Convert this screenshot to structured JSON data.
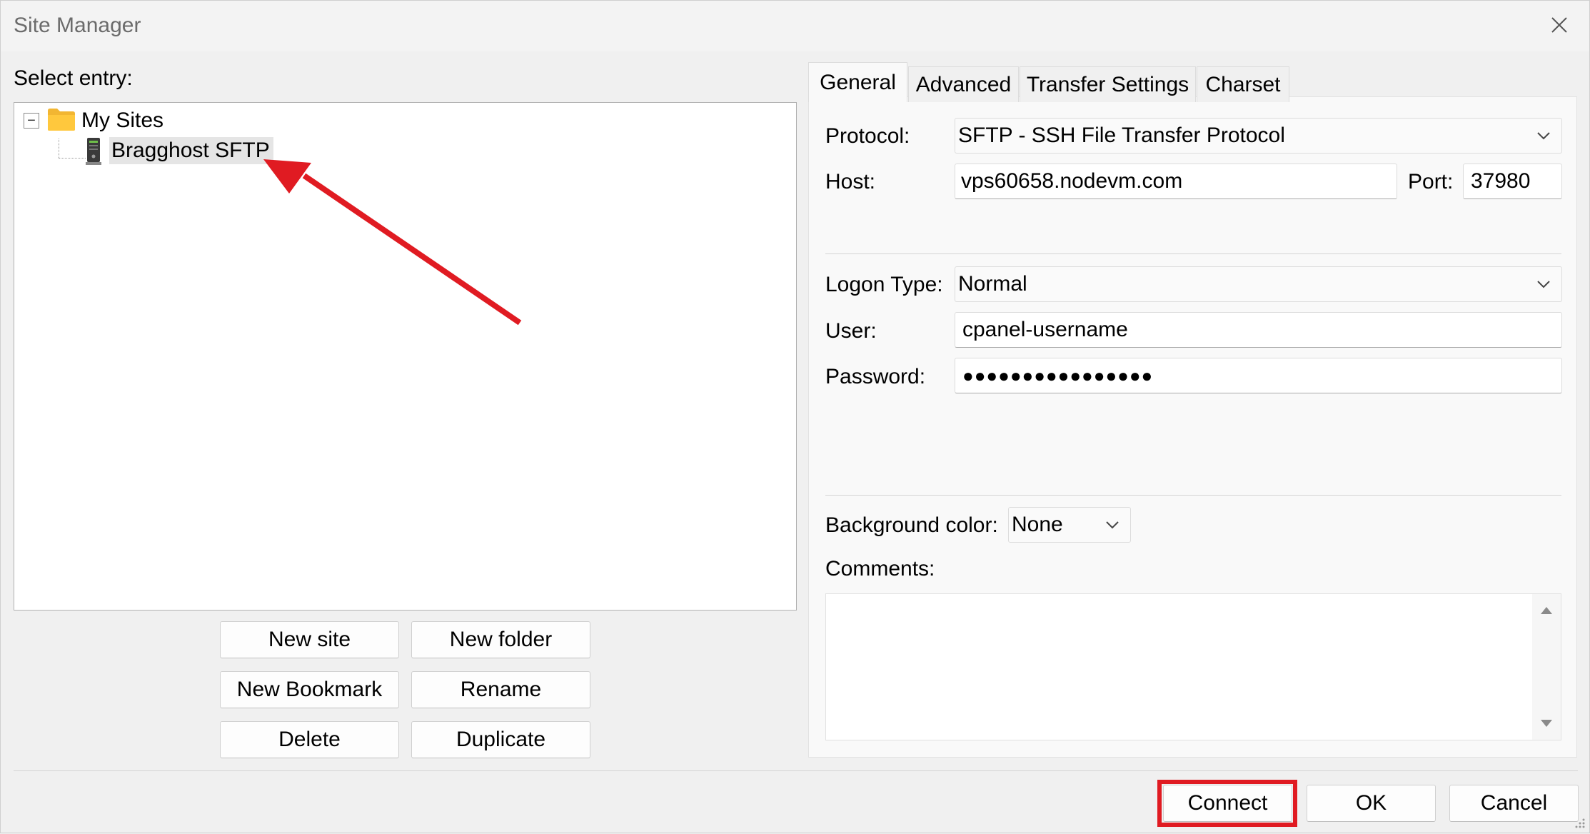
{
  "window": {
    "title": "Site Manager"
  },
  "left": {
    "select_entry_label": "Select entry:",
    "tree": {
      "root_label": "My Sites",
      "expander": "−",
      "site_label": "Bragghost SFTP"
    },
    "buttons": {
      "new_site": "New site",
      "new_folder": "New folder",
      "new_bookmark": "New Bookmark",
      "rename": "Rename",
      "delete": "Delete",
      "duplicate": "Duplicate"
    }
  },
  "tabs": [
    {
      "label": "General",
      "active": true
    },
    {
      "label": "Advanced",
      "active": false
    },
    {
      "label": "Transfer Settings",
      "active": false
    },
    {
      "label": "Charset",
      "active": false
    }
  ],
  "general": {
    "protocol_label": "Protocol:",
    "protocol_value": "SFTP - SSH File Transfer Protocol",
    "host_label": "Host:",
    "host_value": "vps60658.nodevm.com",
    "port_label": "Port:",
    "port_value": "37980",
    "logon_type_label": "Logon Type:",
    "logon_type_value": "Normal",
    "user_label": "User:",
    "user_value": "cpanel-username",
    "password_label": "Password:",
    "password_value": "●●●●●●●●●●●●●●●●",
    "bgcolor_label": "Background color:",
    "bgcolor_value": "None",
    "comments_label": "Comments:",
    "comments_value": ""
  },
  "footer": {
    "connect": "Connect",
    "ok": "OK",
    "cancel": "Cancel"
  },
  "annotation": {
    "color": "#e01b22"
  },
  "icons": {
    "close": "close-icon",
    "folder": "folder-icon",
    "server": "server-icon",
    "chevron": "chevron-down-icon",
    "scroll_up": "scroll-up-arrow-icon",
    "scroll_down": "scroll-down-arrow-icon"
  }
}
